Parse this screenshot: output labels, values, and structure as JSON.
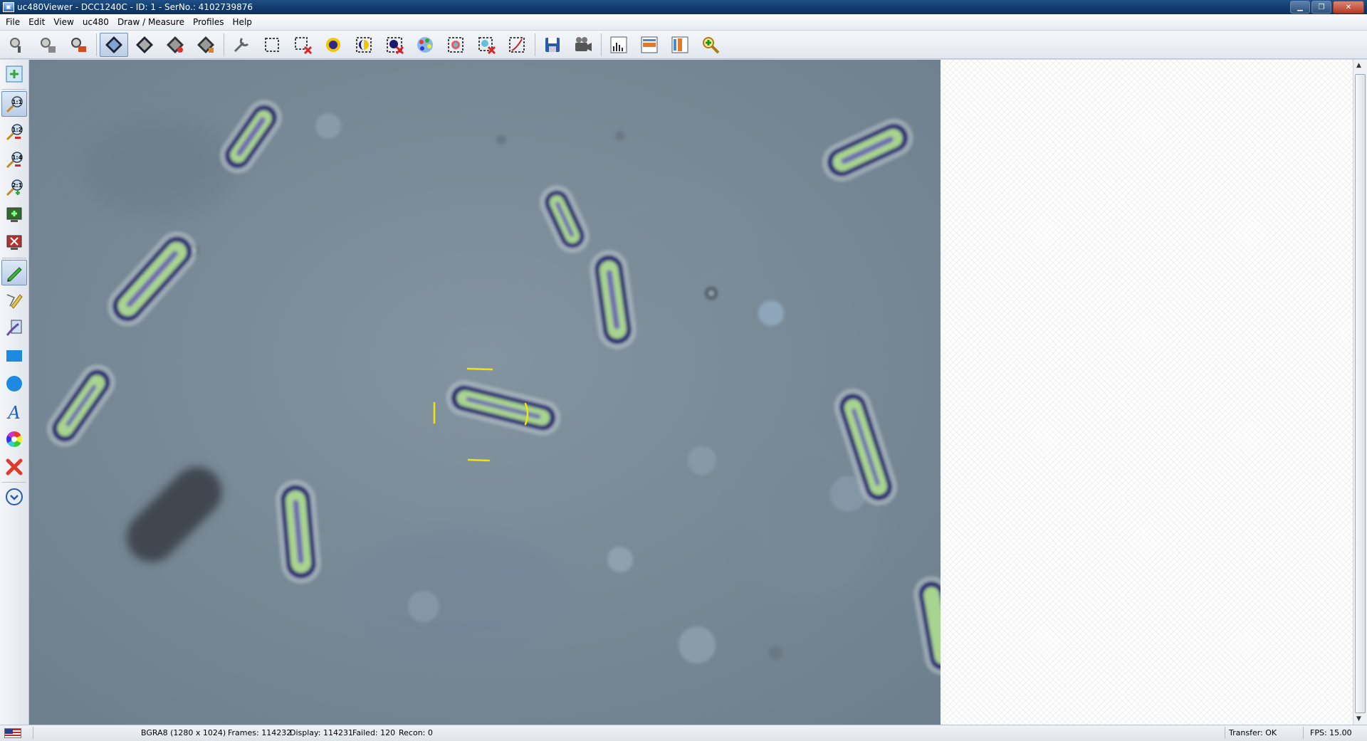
{
  "window": {
    "title": "uc480Viewer - DCC1240C - ID: 1 - SerNo.: 4102739876",
    "app_icon": "uc480-camera-icon",
    "controls": [
      "minimize",
      "restore",
      "close"
    ]
  },
  "menu": {
    "items": [
      "File",
      "Edit",
      "View",
      "uc480",
      "Draw / Measure",
      "Profiles",
      "Help"
    ]
  },
  "toolbar": {
    "buttons": [
      "open-camera-icon",
      "open-camera-settings-icon",
      "close-camera-icon",
      "live-video-icon",
      "snapshot-icon",
      "live-video-record-icon",
      "stop-video-icon",
      "camera-properties-icon",
      "aoi-icon",
      "aoi-reset-icon",
      "auto-exposure-icon",
      "hot-pixel-icon",
      "hot-pixel-off-icon",
      "color-palette-icon",
      "image-adjust-icon",
      "image-adjust-reset-icon",
      "ruler-icon",
      "save-image-icon",
      "video-camera-icon",
      "histogram-icon",
      "line-profile-icon",
      "column-profile-icon",
      "zoom-in-icon"
    ],
    "active": "live-video-icon"
  },
  "left_toolbar": {
    "buttons": [
      {
        "icon": "fit-to-window-icon",
        "label": ""
      },
      {
        "icon": "zoom-1-1-icon",
        "label": "1:1"
      },
      {
        "icon": "zoom-1-2-icon",
        "label": "1:2"
      },
      {
        "icon": "zoom-1-4-icon",
        "label": "1:4"
      },
      {
        "icon": "zoom-2-1-icon",
        "label": "2:1"
      },
      {
        "icon": "display-on-icon",
        "label": ""
      },
      {
        "icon": "display-off-icon",
        "label": ""
      },
      {
        "icon": "pencil-icon",
        "label": ""
      },
      {
        "icon": "polyline-icon",
        "label": ""
      },
      {
        "icon": "measure-icon",
        "label": ""
      },
      {
        "icon": "rectangle-icon",
        "label": ""
      },
      {
        "icon": "circle-icon",
        "label": ""
      },
      {
        "icon": "text-icon",
        "label": "A"
      },
      {
        "icon": "color-wheel-icon",
        "label": ""
      },
      {
        "icon": "delete-drawing-icon",
        "label": ""
      },
      {
        "icon": "clock-icon",
        "label": ""
      }
    ]
  },
  "status": {
    "format": "BGRA8 (1280 x 1024)",
    "frames": "Frames: 114232",
    "display": "Display: 114231",
    "failed": "Failed: 120",
    "recon": "Recon: 0",
    "transfer": "Transfer: OK",
    "fps": "FPS: 15.00"
  },
  "colors": {
    "title_bar": "#173f6f",
    "image_background": "#7d8f9c",
    "annotation": "#f2e600"
  }
}
